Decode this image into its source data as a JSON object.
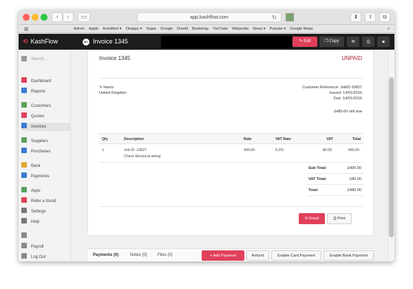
{
  "browser": {
    "url": "app.kashflow.com",
    "favorites": [
      "Admin",
      "Apple",
      "AutoAlert ▾",
      "Okappy ▾",
      "Sugar",
      "Google",
      "Duedil",
      "Bootstrap",
      "YouTube",
      "Wikipedia",
      "News ▾",
      "Popular ▾",
      "Google Maps"
    ]
  },
  "header": {
    "brand": "KashFlow",
    "title": "Invoice 1345",
    "edit_label": "Edit",
    "copy_label": "Copy"
  },
  "sidebar": {
    "search_placeholder": "Search...",
    "items": [
      {
        "label": "Dashboard",
        "icon": "dashboard-icon",
        "color": "#e0405a"
      },
      {
        "label": "Reports",
        "icon": "reports-icon",
        "color": "#3a7bd5"
      },
      {
        "label": "Customers",
        "icon": "customers-icon",
        "color": "#5aa05a"
      },
      {
        "label": "Quotes",
        "icon": "quotes-icon",
        "color": "#e0405a"
      },
      {
        "label": "Invoices",
        "icon": "invoices-icon",
        "color": "#3a7bd5"
      },
      {
        "label": "Suppliers",
        "icon": "suppliers-icon",
        "color": "#5aa05a"
      },
      {
        "label": "Purchases",
        "icon": "purchases-icon",
        "color": "#3a7bd5"
      },
      {
        "label": "Bank",
        "icon": "bank-icon",
        "color": "#e3a634"
      },
      {
        "label": "Payments",
        "icon": "payments-icon",
        "color": "#3a7bd5"
      },
      {
        "label": "Apps",
        "icon": "apps-icon",
        "color": "#5aa05a"
      },
      {
        "label": "Refer a friend",
        "icon": "heart-icon",
        "color": "#e0405a"
      },
      {
        "label": "Settings",
        "icon": "gear-icon",
        "color": "#777777"
      },
      {
        "label": "Help",
        "icon": "help-icon",
        "color": "#777777"
      },
      {
        "label": "",
        "icon": "user-icon",
        "color": "#888888"
      },
      {
        "label": "Payroll",
        "icon": "payroll-icon",
        "color": "#888888"
      },
      {
        "label": "Log Out",
        "icon": "logout-icon",
        "color": "#888888"
      }
    ]
  },
  "invoice": {
    "title": "Invoice 1345",
    "status": "UNPAID",
    "customer_name": "Harris",
    "customer_country": "United Kingdom",
    "customer_reference": "Customer Reference: JobID-10827",
    "issued": "Issued: 14/01/2016",
    "due": "Due: 14/01/2016",
    "still_due": "£480.00 still due",
    "table": {
      "headers": [
        "Qty",
        "Description",
        "Rate",
        "VAT Rate",
        "VAT",
        "Total"
      ],
      "rows": [
        {
          "qty": "1",
          "desc_line1": "Job ID: 10827",
          "desc_line2": "Check Electrical wiring",
          "rate": "400.00",
          "vat_rate": "0.2%",
          "vat": "80.00",
          "total": "480.00"
        }
      ]
    },
    "totals": [
      {
        "label": "Sub Total:",
        "value": "£400.00"
      },
      {
        "label": "VAT Total:",
        "value": "£80.00"
      },
      {
        "label": "Total:",
        "value": "£480.00"
      }
    ],
    "email_label": "Email",
    "print_label": "Print"
  },
  "bottom": {
    "tabs": [
      "Payments (0)",
      "Notes (0)",
      "Files (0)"
    ],
    "add_payment_label": "Add Payment",
    "refund_label": "Refund",
    "card_payment_label": "Enable Card Payment",
    "bank_payment_label": "Enable Bank Payment"
  },
  "colors": {
    "accent": "#e0405a",
    "unpaid": "#a8222e",
    "header_bg": "#1c1c1c"
  }
}
